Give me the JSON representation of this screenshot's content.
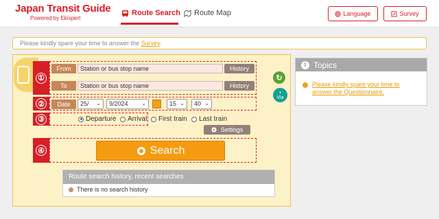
{
  "header": {
    "title": "Japan Transit Guide",
    "subtitle": "Powered by Ekispert",
    "tabs": [
      {
        "label": "Route Search",
        "active": true,
        "icon": "bus-icon"
      },
      {
        "label": "Route Map",
        "active": false,
        "icon": "map-icon"
      }
    ],
    "language_label": "Language",
    "survey_label": "Survey",
    "accent_color": "#d81e26"
  },
  "notice": {
    "text": "Please kindly spare your time to answer the ",
    "link": "Survey",
    "end": "."
  },
  "search": {
    "steps": [
      "①",
      "②",
      "③",
      "④"
    ],
    "from_label": "From",
    "to_label": "To",
    "from_placeholder": "Station or bus stop name",
    "to_placeholder": "Station or bus stop name",
    "history_label": "History",
    "date_label": "Date",
    "day": "25/",
    "month_year": "9/2024",
    "hour": "15",
    "minute": "40",
    "time_options": [
      {
        "label": "Departure",
        "selected": true
      },
      {
        "label": "Arrival",
        "selected": false
      },
      {
        "label": "First train",
        "selected": false
      },
      {
        "label": "Last train",
        "selected": false
      }
    ],
    "settings_label": "Settings",
    "search_label": "Search",
    "via_plus": "+",
    "via_label": "Via",
    "search_button_color": "#f49b10"
  },
  "history_panel": {
    "title": "Route search history, recent searches",
    "empty_text": "There is no search history"
  },
  "topics": {
    "title": "Topics",
    "items": [
      "Please kindly spare your time to answer the Questionnaire."
    ]
  }
}
